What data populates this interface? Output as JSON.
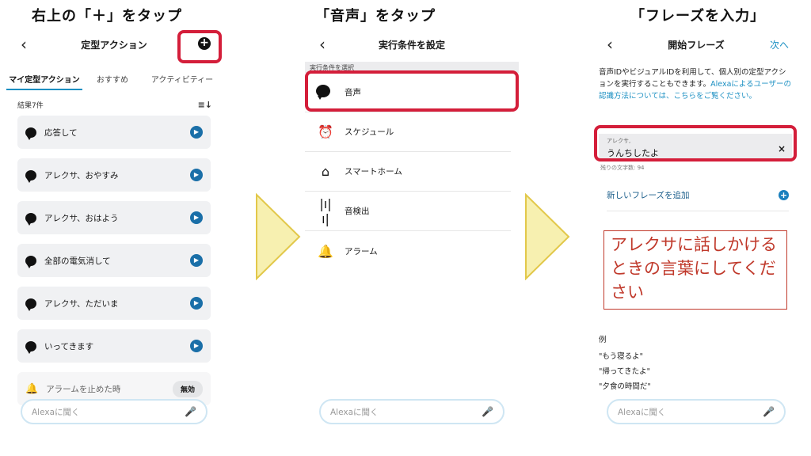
{
  "captions": {
    "step1": "右上の「＋」をタップ",
    "step2": "「音声」をタップ",
    "step3": "「フレーズを入力」"
  },
  "panel1": {
    "back": "‹",
    "title": "定型アクション",
    "plus": "+",
    "tabs": [
      "マイ定型アクション",
      "おすすめ",
      "アクティビティー"
    ],
    "results": "結果7件",
    "sort_icon": "≡↓",
    "routines": [
      {
        "label": "応答して"
      },
      {
        "label": "アレクサ、おやすみ"
      },
      {
        "label": "アレクサ、おはよう"
      },
      {
        "label": "全部の電気消して"
      },
      {
        "label": "アレクサ、ただいま"
      },
      {
        "label": "いってきます"
      }
    ],
    "disabled_routine": {
      "label": "アラームを止めた時",
      "badge": "無効"
    },
    "alexa_placeholder": "Alexaに聞く"
  },
  "panel2": {
    "back": "‹",
    "title": "実行条件を設定",
    "section": "実行条件を選択",
    "conditions": [
      {
        "label": "音声",
        "icon": "speech-bubble-icon"
      },
      {
        "label": "スケジュール",
        "icon": "alarm-clock-icon"
      },
      {
        "label": "スマートホーム",
        "icon": "smart-home-icon"
      },
      {
        "label": "音検出",
        "icon": "sound-wave-icon"
      },
      {
        "label": "アラーム",
        "icon": "bell-icon"
      }
    ],
    "alexa_placeholder": "Alexaに聞く"
  },
  "panel3": {
    "back": "‹",
    "title": "開始フレーズ",
    "next": "次へ",
    "desc_text": "音声IDやビジュアルIDを利用して、個人別の定型アクションを実行することもできます。",
    "desc_link": "Alexaによるユーザーの認識方法については、こちらをご覧ください。",
    "phrase_label": "アレクサ,",
    "phrase_value": "うんちしたよ",
    "remaining": "残りの文字数: 94",
    "add_phrase": "新しいフレーズを追加",
    "note": "アレクサに話しかけるときの言葉にしてください",
    "example_title": "例",
    "examples": [
      "\"もう寝るよ\"",
      "\"帰ってきたよ\"",
      "\"夕食の時間だ\""
    ],
    "alexa_placeholder": "Alexaに聞く"
  },
  "colors": {
    "highlight": "#d41e3a",
    "accent": "#1a8fc2",
    "arrow_fill": "#f7f0b0",
    "arrow_stroke": "#e2c84a"
  }
}
